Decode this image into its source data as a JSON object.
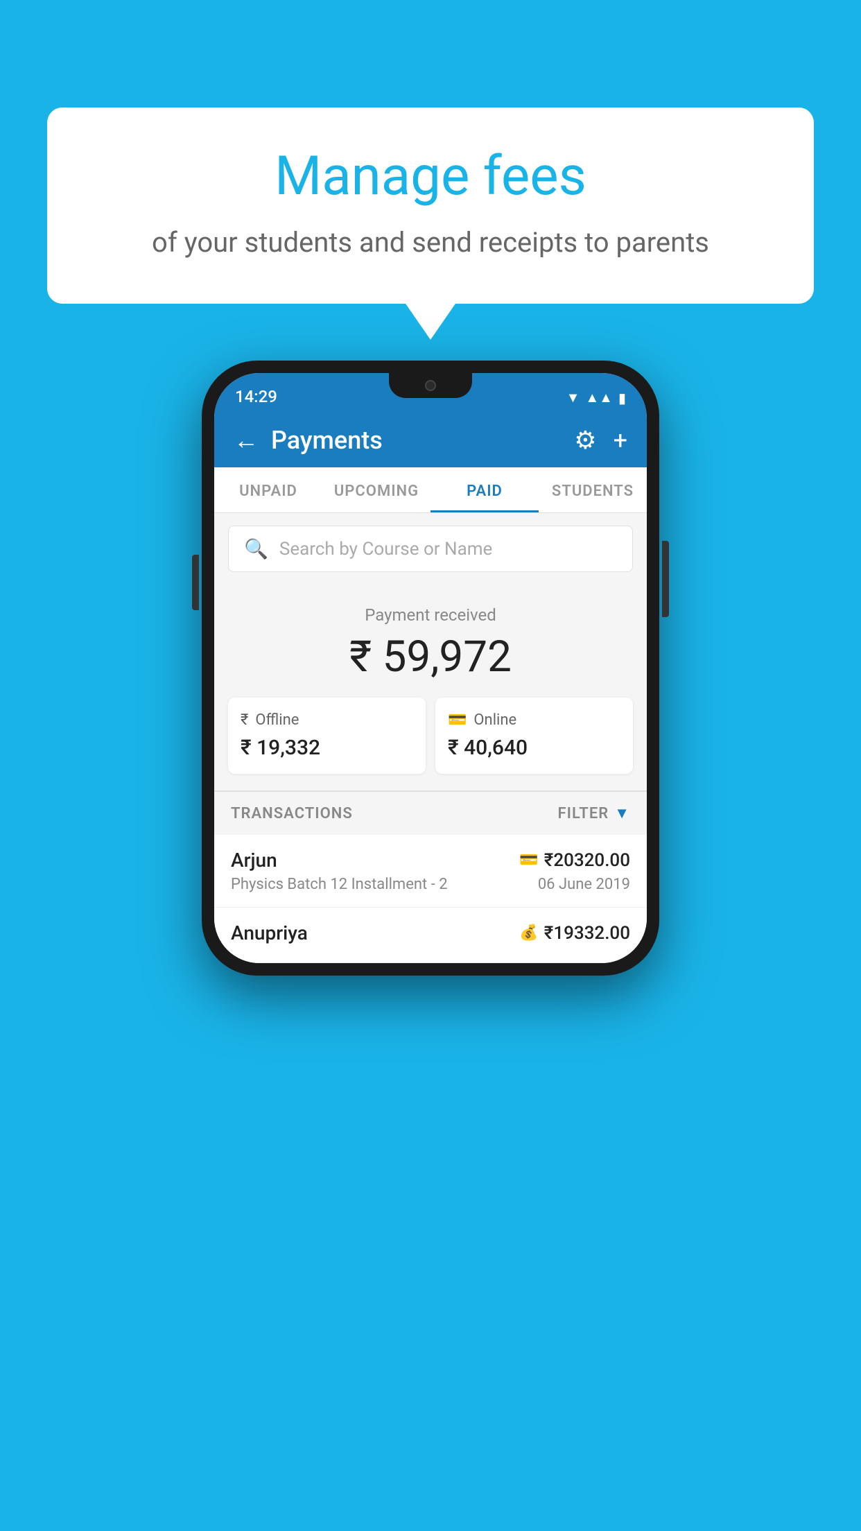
{
  "background_color": "#1ab3e8",
  "bubble": {
    "title": "Manage fees",
    "subtitle": "of your students and send receipts to parents"
  },
  "status_bar": {
    "time": "14:29",
    "icons": [
      "wifi",
      "signal",
      "battery"
    ]
  },
  "header": {
    "title": "Payments",
    "back_label": "←",
    "gear_label": "⚙",
    "plus_label": "+"
  },
  "tabs": [
    {
      "label": "UNPAID",
      "active": false
    },
    {
      "label": "UPCOMING",
      "active": false
    },
    {
      "label": "PAID",
      "active": true
    },
    {
      "label": "STUDENTS",
      "active": false
    }
  ],
  "search": {
    "placeholder": "Search by Course or Name"
  },
  "payment_section": {
    "label": "Payment received",
    "total_amount": "₹ 59,972",
    "offline": {
      "label": "Offline",
      "amount": "₹ 19,332"
    },
    "online": {
      "label": "Online",
      "amount": "₹ 40,640"
    }
  },
  "transactions": {
    "section_label": "TRANSACTIONS",
    "filter_label": "FILTER",
    "rows": [
      {
        "name": "Arjun",
        "course": "Physics Batch 12 Installment - 2",
        "amount": "₹20320.00",
        "date": "06 June 2019",
        "payment_type": "card"
      },
      {
        "name": "Anupriya",
        "course": "",
        "amount": "₹19332.00",
        "date": "",
        "payment_type": "rupee"
      }
    ]
  }
}
